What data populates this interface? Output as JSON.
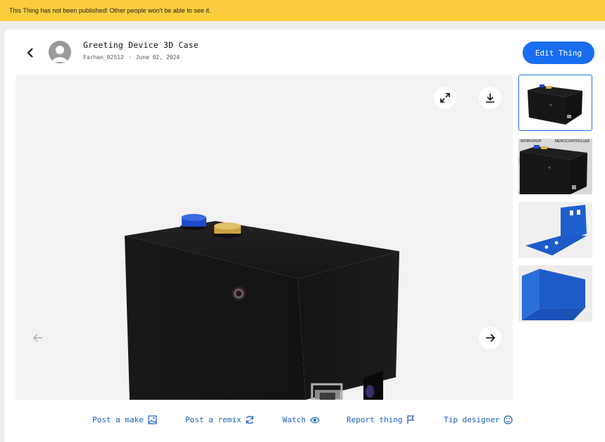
{
  "banner": {
    "text": "This Thing has not been published! Other people won't be able to see it."
  },
  "header": {
    "title": "Greeting Device 3D Case",
    "author": "Farhan_02512",
    "separator": "·",
    "date": "June 02, 2024",
    "edit_label": "Edit Thing"
  },
  "viewer": {
    "fullscreen_icon": "expand-icon",
    "download_icon": "download-icon",
    "prev_icon": "arrow-left-icon",
    "next_icon": "arrow-right-icon"
  },
  "thumbnails": [
    {
      "name": "black-box-render",
      "selected": true
    },
    {
      "name": "black-box-workshop",
      "selected": false
    },
    {
      "name": "blue-bracket-top",
      "selected": false
    },
    {
      "name": "blue-bracket-side",
      "selected": false
    }
  ],
  "thumb_labels": {
    "left": "WORKSHOP",
    "right": "MEROCONTROLLER"
  },
  "actions": [
    {
      "label": "Post a make",
      "icon": "image-icon"
    },
    {
      "label": "Post a remix",
      "icon": "refresh-icon"
    },
    {
      "label": "Watch",
      "icon": "eye-icon"
    },
    {
      "label": "Report thing",
      "icon": "flag-icon"
    },
    {
      "label": "Tip designer",
      "icon": "smile-icon"
    }
  ],
  "colors": {
    "accent": "#196ef0",
    "banner": "#f9cd3d",
    "link": "#1a5fc0",
    "blue_cap": "#1f49c9",
    "yellow_cap": "#d8b44a"
  }
}
